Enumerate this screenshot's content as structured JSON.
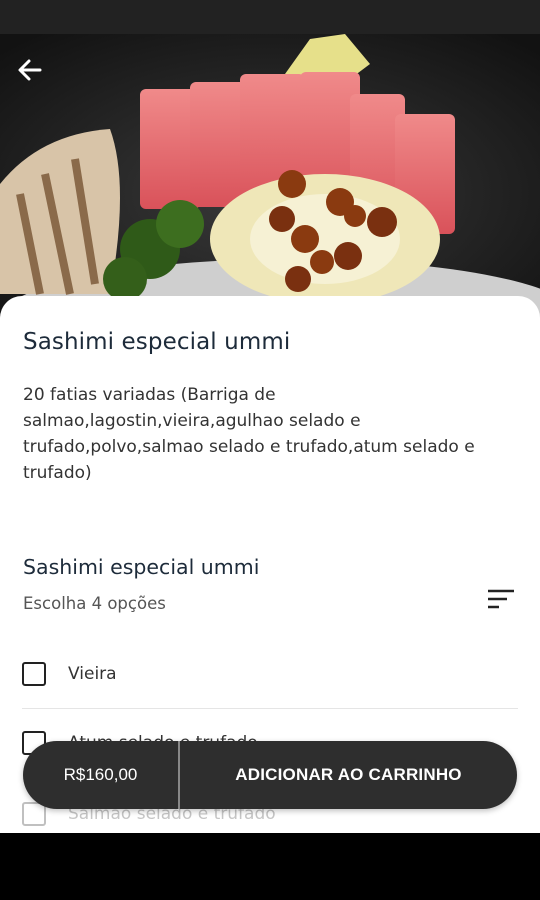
{
  "product": {
    "title": "Sashimi especial ummi",
    "description": "20 fatias variadas (Barriga de salmao,lagostin,vieira,agulhao selado e trufado,polvo,salmao selado e trufado,atum selado e trufado)"
  },
  "options_section": {
    "title": "Sashimi especial ummi",
    "subtitle": "Escolha 4 opções",
    "options": [
      {
        "label": "Vieira",
        "checked": false
      },
      {
        "label": "Atum selado e trufado",
        "checked": false
      },
      {
        "label": "Salmao selado e trufado",
        "checked": false
      }
    ]
  },
  "cart": {
    "price": "R$160,00",
    "add_label": "ADICIONAR AO CARRINHO"
  },
  "icons": {
    "back": "arrow-left-icon",
    "sort": "sort-lines-icon",
    "checkbox": "checkbox-icon"
  },
  "colors": {
    "cart_bar": "#2e2e2e",
    "title": "#1d2b3a",
    "sheet": "#ffffff"
  }
}
